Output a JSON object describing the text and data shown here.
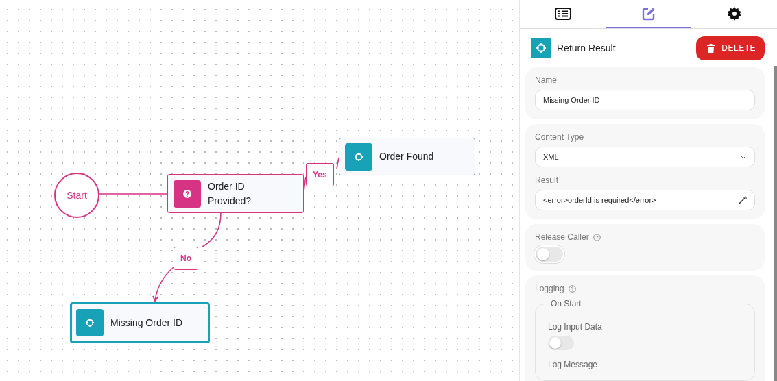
{
  "canvas": {
    "nodes": [
      {
        "kind": "start",
        "label": "Start",
        "selected": false
      },
      {
        "kind": "decision",
        "label": "Order ID Provided?",
        "selected": false
      },
      {
        "kind": "result",
        "label": "Order Found",
        "selected": false
      },
      {
        "kind": "result",
        "label": "Missing Order ID",
        "selected": true
      }
    ],
    "edges": [
      {
        "label": "Yes"
      },
      {
        "label": "No"
      }
    ]
  },
  "panel": {
    "tabs": [
      {
        "selected": false
      },
      {
        "selected": true
      },
      {
        "selected": false
      }
    ],
    "header": {
      "title": "Return Result",
      "delete_button": "DELETE"
    },
    "name": {
      "label": "Name",
      "value": "Missing Order ID"
    },
    "content_type": {
      "label": "Content Type",
      "value": "XML"
    },
    "result": {
      "label": "Result",
      "value": "<error>orderId is required</error>"
    },
    "release_caller": {
      "label": "Release Caller",
      "on": false
    },
    "logging": {
      "label": "Logging",
      "group": "On Start",
      "log_input_data": {
        "label": "Log Input Data",
        "on": false
      },
      "log_message": {
        "label": "Log Message"
      }
    }
  }
}
